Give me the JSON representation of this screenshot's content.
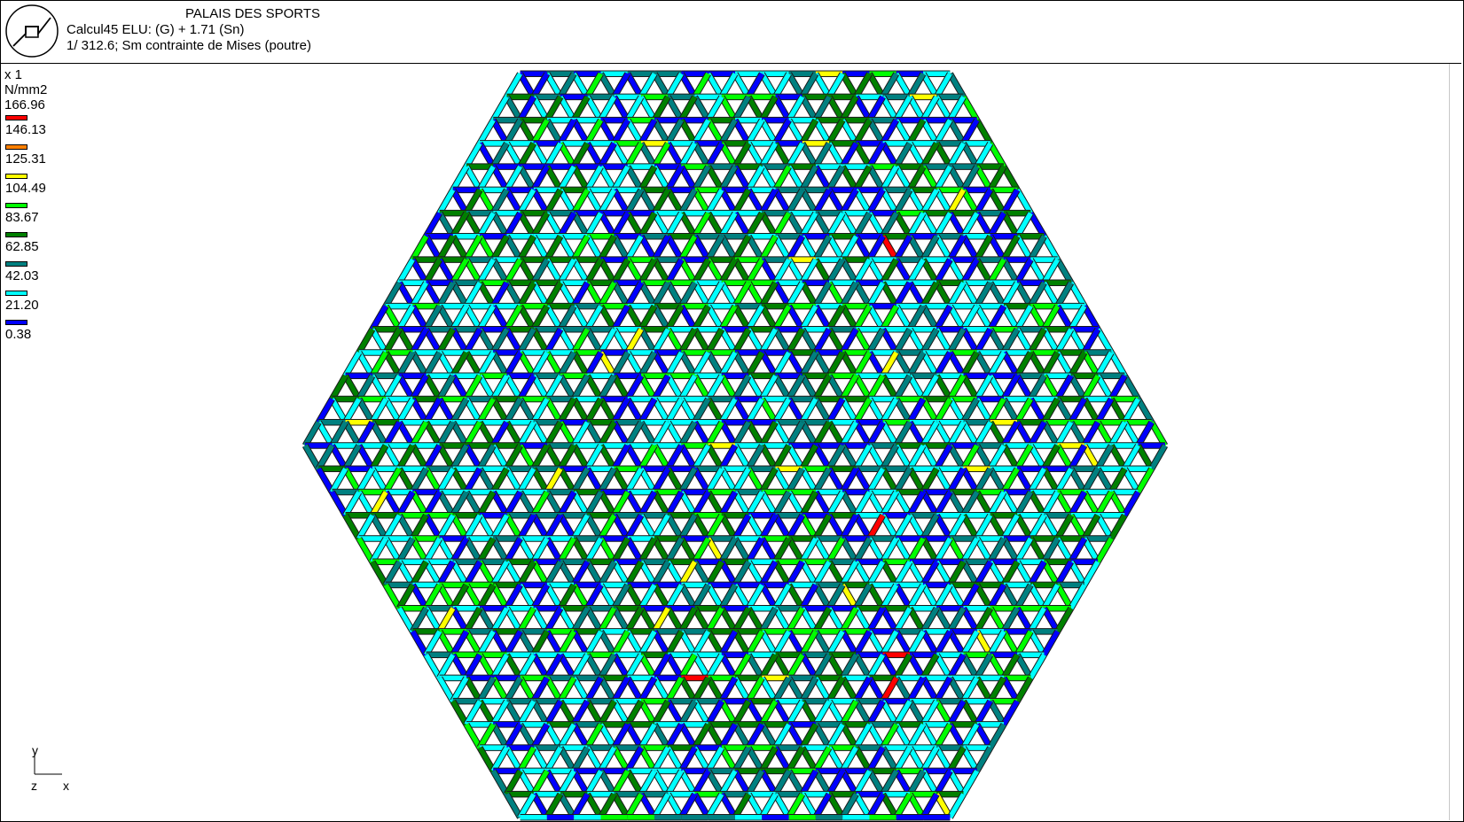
{
  "header": {
    "title": "PALAIS DES SPORTS",
    "calculation": "Calcul45 ELU: (G) + 1.71 (Sn)",
    "scale_result": "1/ 312.6; Sm  contrainte de Mises (poutre)"
  },
  "legend": {
    "unit": "x 1 N/mm2",
    "top_value": "166.96",
    "items": [
      {
        "label": "146.13",
        "color": "#ff0000"
      },
      {
        "label": "125.31",
        "color": "#ff8000"
      },
      {
        "label": "104.49",
        "color": "#ffff00"
      },
      {
        "label": "83.67",
        "color": "#00ff00"
      },
      {
        "label": "62.85",
        "color": "#008000"
      },
      {
        "label": "42.03",
        "color": "#008080"
      },
      {
        "label": "21.20",
        "color": "#00ffff"
      },
      {
        "label": "0.38",
        "color": "#0000ff"
      }
    ]
  },
  "axes": {
    "y_label": "y",
    "x_label": "x",
    "z_label": "z"
  },
  "model": {
    "shape": "hexagonal triangulated grid",
    "members_per_side": 16,
    "colors": {
      "blue": "#0000ff",
      "cyan": "#00ffff",
      "teal": "#008080",
      "green": "#008000",
      "lime": "#00ff00",
      "yellow": "#ffff00",
      "orange": "#ff8000",
      "red": "#ff0000"
    }
  }
}
